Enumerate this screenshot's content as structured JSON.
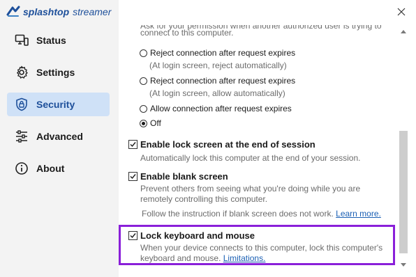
{
  "app": {
    "brand": "splashtop",
    "product": "streamer"
  },
  "sidebar": {
    "items": [
      {
        "label": "Status",
        "icon": "monitor-icon",
        "active": false
      },
      {
        "label": "Settings",
        "icon": "gear-icon",
        "active": false
      },
      {
        "label": "Security",
        "icon": "shield-lock-icon",
        "active": true
      },
      {
        "label": "Advanced",
        "icon": "sliders-icon",
        "active": false
      },
      {
        "label": "About",
        "icon": "info-icon",
        "active": false
      }
    ]
  },
  "content": {
    "partial_top_line_1": "Ask for your permission when another authorized user is trying to",
    "partial_top_line_2": "connect to this computer.",
    "radio_options": [
      {
        "label": "Reject connection after request expires",
        "sub": "(At login screen, reject automatically)",
        "selected": false
      },
      {
        "label": "Reject connection after request expires",
        "sub": "(At login screen, allow automatically)",
        "selected": false
      },
      {
        "label": "Allow connection after request expires",
        "sub": "",
        "selected": false
      },
      {
        "label": "Off",
        "sub": "",
        "selected": true
      }
    ],
    "lock_screen": {
      "label": "Enable lock screen at the end of session",
      "desc": "Automatically lock this computer at the end of your session.",
      "checked": true
    },
    "blank_screen": {
      "label": "Enable blank screen",
      "desc_1": "Prevent others from seeing what you're doing while you are",
      "desc_2": "remotely controlling this computer.",
      "follow": "Follow the instruction if blank screen does not work.",
      "link": "Learn more.",
      "checked": true
    },
    "lock_keyboard": {
      "label": "Lock keyboard and mouse",
      "desc_1": "When your device connects to this computer, lock this computer's",
      "desc_2": "keyboard and mouse.",
      "link": "Limitations.",
      "checked": true
    }
  },
  "colors": {
    "highlight": "#8a1fd9",
    "active_nav": "#cfe1f7",
    "link": "#1a5fb4"
  }
}
